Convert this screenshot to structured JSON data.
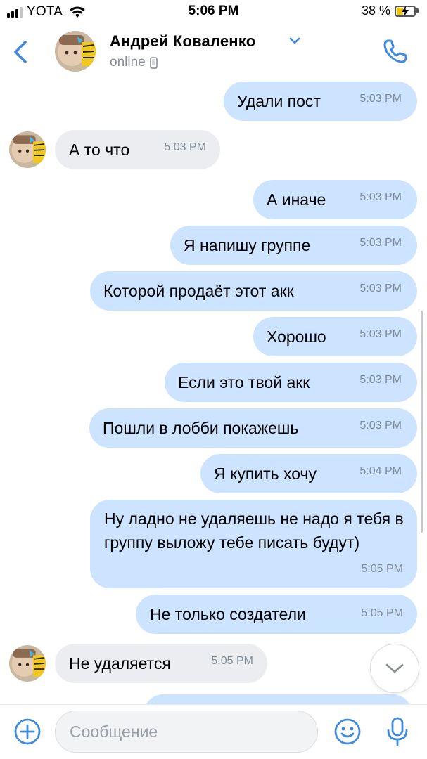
{
  "status_bar": {
    "carrier": "YOTA",
    "time": "5:06 PM",
    "battery": "38 %"
  },
  "header": {
    "name": "Андрей Коваленко",
    "status": "online"
  },
  "messages": [
    {
      "dir": "out",
      "text": "Удали пост",
      "time": "5:03 PM"
    },
    {
      "dir": "in",
      "text": "А то что",
      "time": "5:03 PM"
    },
    {
      "dir": "out",
      "text": "А иначе",
      "time": "5:03 PM"
    },
    {
      "dir": "out",
      "text": "Я напишу группе",
      "time": "5:03 PM"
    },
    {
      "dir": "out",
      "text": "Которой продаёт этот акк",
      "time": "5:03 PM"
    },
    {
      "dir": "out",
      "text": "Хорошо",
      "time": "5:03 PM"
    },
    {
      "dir": "out",
      "text": "Если это твой акк",
      "time": "5:03 PM"
    },
    {
      "dir": "out",
      "text": "Пошли в лобби покажешь",
      "time": "5:03 PM"
    },
    {
      "dir": "out",
      "text": "Я купить хочу",
      "time": "5:04 PM"
    },
    {
      "dir": "out",
      "text": "Ну ладно не удаляешь не надо я тебя в группу выложу тебе писать будут)",
      "time": "5:05 PM"
    },
    {
      "dir": "out",
      "text": "Не только создатели",
      "time": "5:05 PM"
    },
    {
      "dir": "in",
      "text": "Не удаляется",
      "time": "5:05 PM"
    }
  ],
  "composer": {
    "placeholder": "Сообщение"
  },
  "colors": {
    "accent": "#3f8ae0",
    "outgoing_bubble": "#cce4ff",
    "incoming_bubble": "#ebedf0",
    "meta_text": "#818c99"
  },
  "icons": [
    "signal-icon",
    "wifi-icon",
    "battery-icon",
    "back-icon",
    "chevron-down-icon",
    "mobile-icon",
    "phone-icon",
    "scroll-down-icon",
    "plus-icon",
    "smile-icon",
    "mic-icon"
  ]
}
